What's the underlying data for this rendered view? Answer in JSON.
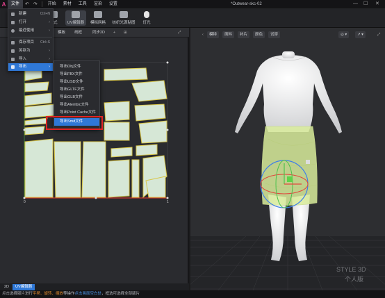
{
  "menubar": {
    "logo": "A",
    "items": [
      "文件",
      "开始",
      "素材",
      "工具",
      "渲染",
      "设置"
    ],
    "title": "*Outwear-skc-02",
    "controls": [
      "—",
      "☐",
      "✕"
    ]
  },
  "toolbar": {
    "buttons": [
      {
        "label": "款式"
      },
      {
        "label": "UV编辑器"
      },
      {
        "label": "模拟网格"
      },
      {
        "label": "纺织光源贴图"
      },
      {
        "label": "灯光"
      }
    ]
  },
  "file_menu": {
    "items": [
      {
        "label": "新建",
        "shortcut": "Ctrl+N"
      },
      {
        "label": "打开",
        "shortcut": ""
      },
      {
        "label": "最近使用",
        "shortcut": ""
      },
      {
        "label": "保存项目",
        "shortcut": "Ctrl+S"
      },
      {
        "label": "另存为",
        "shortcut": ""
      },
      {
        "label": "导入",
        "shortcut": ""
      },
      {
        "label": "导出",
        "shortcut": ""
      }
    ]
  },
  "export_menu": {
    "items": [
      "导出Obj文件",
      "导出FBX文件",
      "导出USD文件",
      "导出GLTF文件",
      "导出GLB文件",
      "导出Alembic文件",
      "导出Point Cache文件",
      "导出Smd文件"
    ]
  },
  "panel2d": {
    "toolbar": [
      "模板",
      "线框",
      "同步2D"
    ],
    "axis_labels": [
      "0",
      "1"
    ]
  },
  "panel3d": {
    "toolbar": [
      "模特",
      "面料",
      "补片",
      "颜色",
      "试穿"
    ]
  },
  "bottom_tabs": [
    "2D",
    "UV编辑器"
  ],
  "status": {
    "prefix": "点击选择版片进行",
    "ops": "平移、旋转、缩放",
    "mid": "等操作",
    "link": "点击画面空白处",
    "suffix": "，框选可选择全部版片"
  },
  "watermark": [
    "STYLE 3D",
    "个人版"
  ]
}
